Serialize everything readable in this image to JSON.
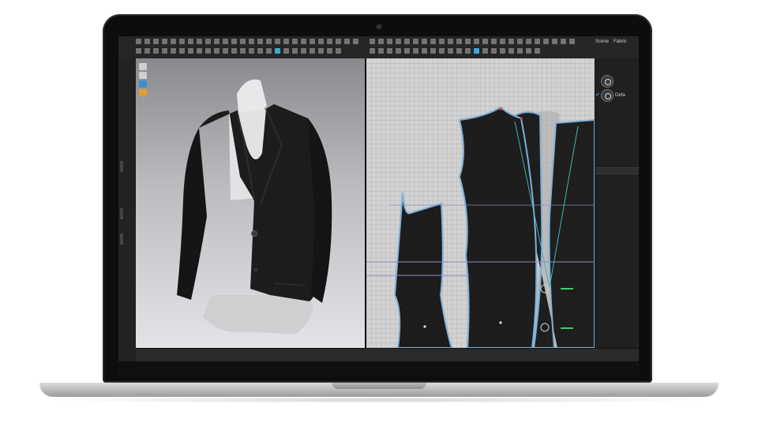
{
  "app": {
    "right_panel_tabs": [
      "Scene",
      "Fabric"
    ],
    "fabric_list": [
      {
        "name": "",
        "checked": false
      },
      {
        "name": "Defa",
        "checked": true
      }
    ]
  },
  "colors": {
    "accent": "#41a7d6",
    "garment": "#1c1c1c",
    "pattern_outline": "#7fb0d8"
  }
}
